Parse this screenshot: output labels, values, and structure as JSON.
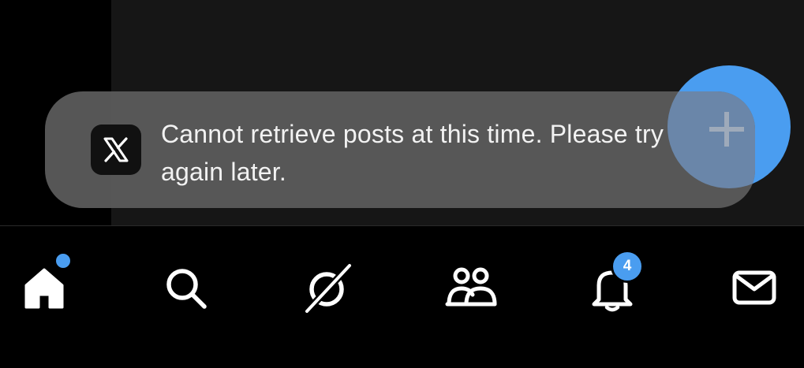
{
  "toast": {
    "message": "Cannot retrieve posts at this time. Please try again later.",
    "logo_icon": "x-logo-icon"
  },
  "compose": {
    "icon": "plus-icon",
    "color": "#4a9df0"
  },
  "tabbar": {
    "items": [
      {
        "name": "home",
        "icon": "home-icon",
        "has_dot": true
      },
      {
        "name": "search",
        "icon": "search-icon"
      },
      {
        "name": "grok",
        "icon": "grok-icon"
      },
      {
        "name": "communities",
        "icon": "people-icon"
      },
      {
        "name": "notifications",
        "icon": "bell-icon",
        "badge": "4"
      },
      {
        "name": "messages",
        "icon": "mail-icon"
      }
    ]
  },
  "colors": {
    "accent": "#4a9df0",
    "background": "#000000",
    "toast_bg": "#5c5c5c"
  }
}
